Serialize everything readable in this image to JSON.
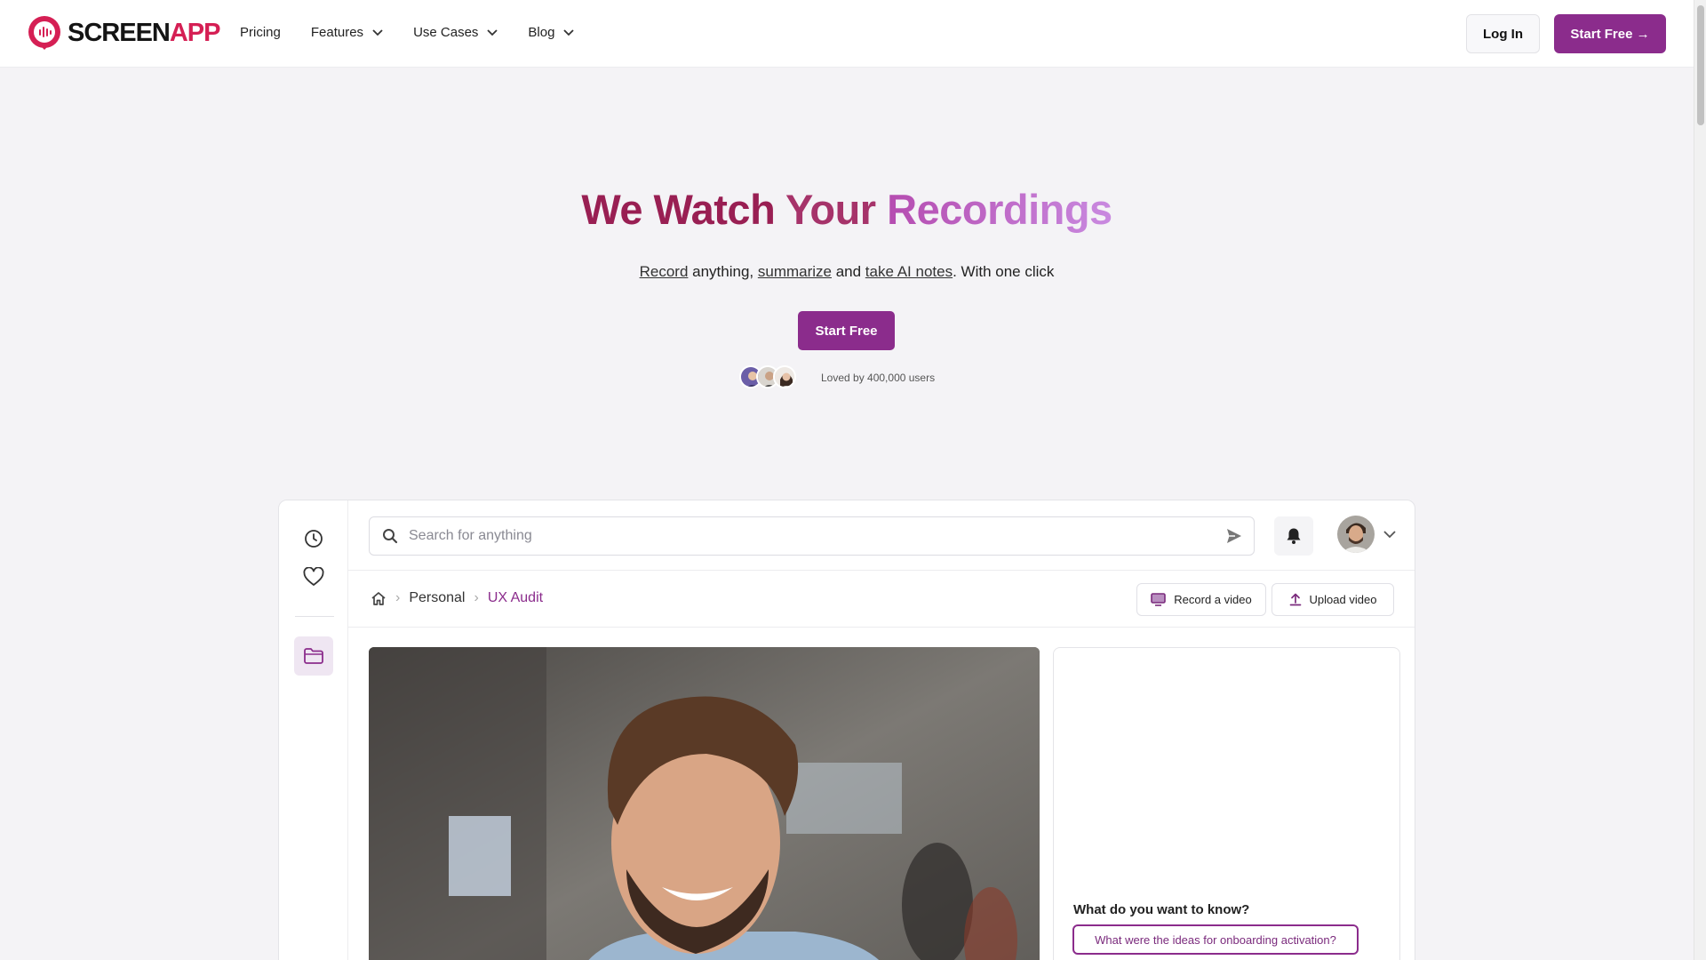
{
  "header": {
    "logo": {
      "part1": "SCREEN",
      "part2": "APP"
    },
    "nav": [
      {
        "label": "Pricing",
        "dropdown": false
      },
      {
        "label": "Features",
        "dropdown": true
      },
      {
        "label": "Use Cases",
        "dropdown": true
      },
      {
        "label": "Blog",
        "dropdown": true
      }
    ],
    "login_label": "Log In",
    "start_free_label": "Start Free →"
  },
  "hero": {
    "title_part1": "We Watch ",
    "title_part2": "Your ",
    "title_part3": "Recordings",
    "sub_link1": "Record",
    "sub_text1": " anything, ",
    "sub_link2": "summarize",
    "sub_text2": " and ",
    "sub_link3": "take AI notes",
    "sub_text3": ". With one click",
    "cta_label": "Start Free",
    "social_proof": "Loved by 400,000 users"
  },
  "app": {
    "search_placeholder": "Search for anything",
    "breadcrumb": {
      "item1": "Personal",
      "item2": "UX Audit"
    },
    "record_label": "Record a video",
    "upload_label": "Upload video",
    "chat": {
      "question": "What do you want to know?",
      "suggestion": "What were the ideas for onboarding activation?"
    }
  },
  "colors": {
    "brand_purple": "#8b2c8c",
    "brand_red": "#d51f54",
    "title_dark": "#991f53",
    "title_light": "#c98ae0"
  }
}
